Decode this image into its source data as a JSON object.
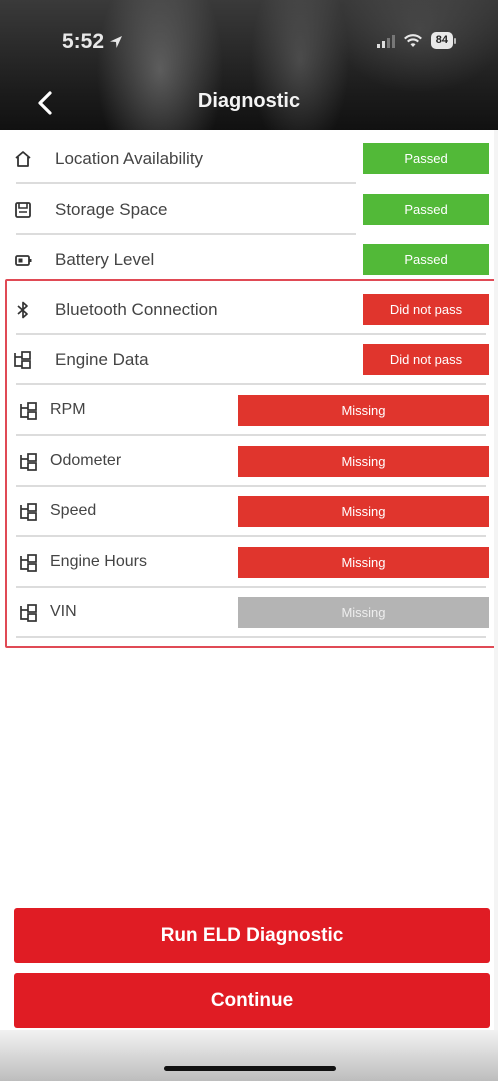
{
  "status_bar": {
    "time": "5:52",
    "battery": "84"
  },
  "nav": {
    "title": "Diagnostic"
  },
  "colors": {
    "passed": "#52b938",
    "failed": "#e0352d",
    "missing_disabled": "#b4b4b4",
    "primary_button": "#e01c24",
    "highlight_border": "#e04a55"
  },
  "checks": [
    {
      "label": "Location Availability",
      "status": "Passed",
      "icon": "home-icon"
    },
    {
      "label": "Storage Space",
      "status": "Passed",
      "icon": "storage-icon"
    },
    {
      "label": "Battery Level",
      "status": "Passed",
      "icon": "battery-icon"
    },
    {
      "label": "Bluetooth Connection",
      "status": "Did not pass",
      "icon": "bluetooth-icon"
    },
    {
      "label": "Engine Data",
      "status": "Did not pass",
      "icon": "engine-data-icon"
    }
  ],
  "engine_params": [
    {
      "label": "RPM",
      "status": "Missing",
      "icon": "engine-data-icon"
    },
    {
      "label": "Odometer",
      "status": "Missing",
      "icon": "engine-data-icon"
    },
    {
      "label": "Speed",
      "status": "Missing",
      "icon": "engine-data-icon"
    },
    {
      "label": "Engine Hours",
      "status": "Missing",
      "icon": "engine-data-icon"
    },
    {
      "label": "VIN",
      "status": "Missing",
      "icon": "engine-data-icon"
    }
  ],
  "buttons": {
    "run_diagnostic": "Run ELD Diagnostic",
    "continue": "Continue"
  }
}
